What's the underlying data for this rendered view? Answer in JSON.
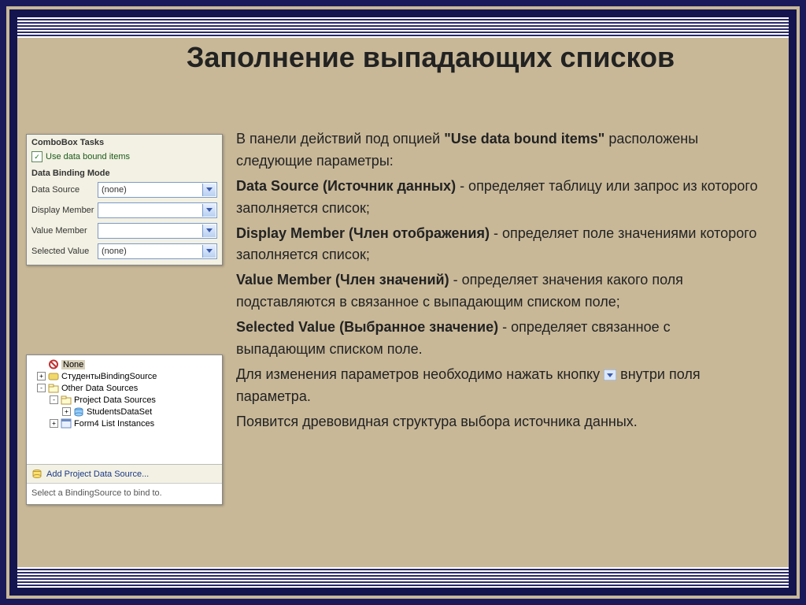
{
  "title": "Заполнение выпадающих списков",
  "body": {
    "p1a": "В панели действий под опцией ",
    "p1b": "\"Use data bound items\"",
    "p1c": " расположены следующие параметры:",
    "p2a": "Data Source (Источник данных)",
    "p2b": " - определяет таблицу или запрос из которого заполняется список;",
    "p3a": "Display Member (Член отображения)",
    "p3b": " - определяет поле значениями которого заполняется список;",
    "p4a": "Value Member (Член значений)",
    "p4b": " - определяет значения какого поля подставляются в связанное с выпадающим списком поле;",
    "p5a": "Selected Value (Выбранное значение)",
    "p5b": " - определяет связанное с выпадающим списком поле.",
    "p6a": "Для изменения параметров необходимо нажать кнопку ",
    "p6b": " внутри поля параметра.",
    "p7": "Появится древовидная структура выбора источника данных."
  },
  "comboPanel": {
    "header": "ComboBox Tasks",
    "checkboxLabel": "Use data bound items",
    "sectionLabel": "Data Binding Mode",
    "fields": [
      {
        "label": "Data Source",
        "value": "(none)"
      },
      {
        "label": "Display Member",
        "value": ""
      },
      {
        "label": "Value Member",
        "value": ""
      },
      {
        "label": "Selected Value",
        "value": "(none)"
      }
    ]
  },
  "treePanel": {
    "nodes": {
      "none": "None",
      "students": "СтудентыBindingSource",
      "other": "Other Data Sources",
      "proj": "Project Data Sources",
      "dataset": "StudentsDataSet",
      "form": "Form4 List Instances"
    },
    "addLink": "Add Project Data Source...",
    "hint": "Select a BindingSource to bind to."
  }
}
